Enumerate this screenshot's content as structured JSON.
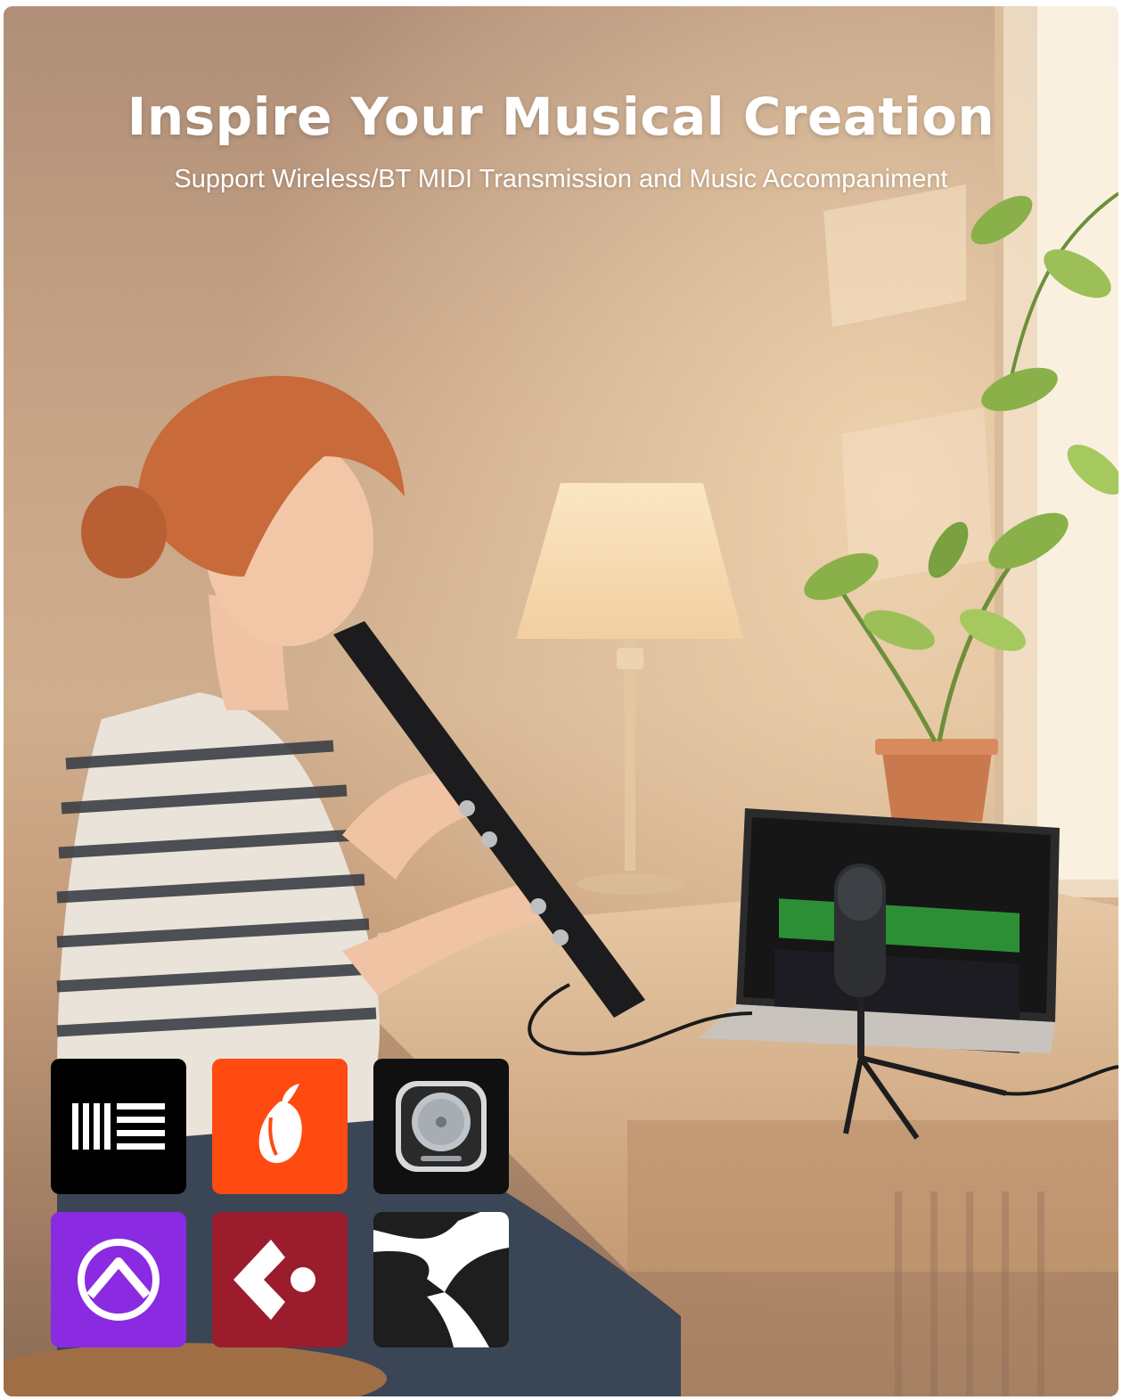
{
  "hero": {
    "headline": "Inspire Your Musical Creation",
    "subheadline": "Support Wireless/BT MIDI Transmission and Music Accompaniment"
  },
  "daw_logos": [
    {
      "icon": "ableton-live-icon",
      "color": "#000000"
    },
    {
      "icon": "fl-studio-icon",
      "color": "#ff4a12"
    },
    {
      "icon": "logic-pro-icon",
      "color": "#101010"
    },
    {
      "icon": "pro-tools-icon",
      "color": "#8a2be2"
    },
    {
      "icon": "cubase-icon",
      "color": "#9b1c2c"
    },
    {
      "icon": "studio-one-icon",
      "color": "#1e1e1e"
    }
  ]
}
